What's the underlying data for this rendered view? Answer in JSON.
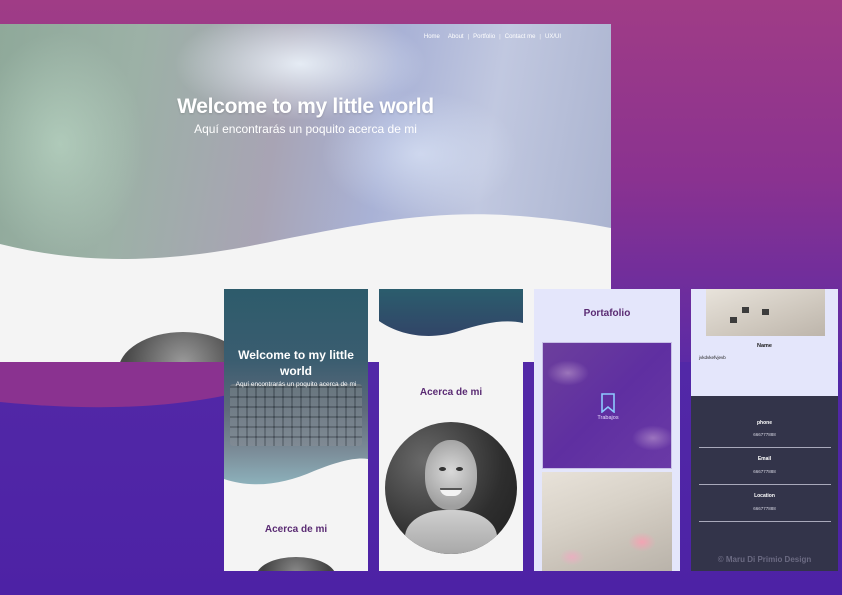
{
  "desktop": {
    "nav": [
      "Home",
      "About",
      "Portfolio",
      "Contact me",
      "UX/UI"
    ],
    "hero_title": "Welcome to my little world",
    "hero_subtitle": "Aquí encontrarás un poquito acerca de mi"
  },
  "phone1": {
    "hero_title": "Welcome to my little world",
    "hero_subtitle": "Aquí encontrarás un poquito acerca de mi",
    "section_title": "Acerca de mi"
  },
  "phone2": {
    "section_title": "Acerca de mi"
  },
  "phone3": {
    "section_title": "Portafolio",
    "card_label": "Trabajos",
    "card_icon": "bookmark-icon"
  },
  "phone4": {
    "name_label": "Name",
    "name_value": "jvkdvkefvjevb",
    "contact": [
      {
        "label": "phone",
        "value": "666777888"
      },
      {
        "label": "Email",
        "value": "666777888"
      },
      {
        "label": "Location",
        "value": "666777888"
      }
    ],
    "copyright": "© Maru Di Primio Design"
  },
  "colors": {
    "background_top": "#a03c86",
    "background_bottom": "#5024a8",
    "accent_purple": "#5a2b73",
    "footer": "#33344a"
  }
}
